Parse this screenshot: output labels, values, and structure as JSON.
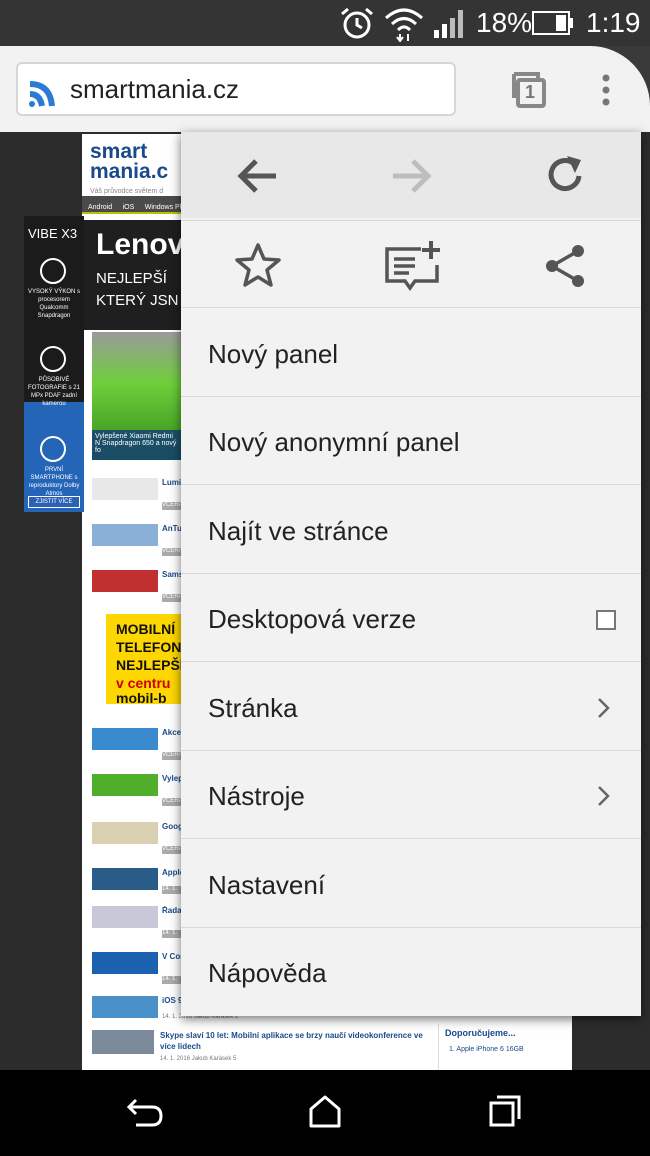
{
  "status_bar": {
    "battery_percent": "18%",
    "time": "1:19",
    "icons": [
      "alarm-icon",
      "wifi-icon",
      "signal-icon",
      "battery-icon"
    ]
  },
  "toolbar": {
    "url": "smartmania.cz",
    "tab_count": "1",
    "icons": [
      "site-logo-icon",
      "tab-switcher-icon",
      "overflow-menu-icon"
    ]
  },
  "menu": {
    "nav_icons": [
      "back-arrow-icon",
      "forward-arrow-icon",
      "reload-icon"
    ],
    "action_icons": [
      "bookmark-star-icon",
      "reading-list-add-icon",
      "share-icon"
    ],
    "items": [
      {
        "label": "Nový panel",
        "kind": "plain"
      },
      {
        "label": "Nový anonymní panel",
        "kind": "plain"
      },
      {
        "label": "Najít ve stránce",
        "kind": "plain"
      },
      {
        "label": "Desktopová verze",
        "kind": "checkbox",
        "checked": false
      },
      {
        "label": "Stránka",
        "kind": "submenu"
      },
      {
        "label": "Nástroje",
        "kind": "submenu"
      },
      {
        "label": "Nastavení",
        "kind": "plain"
      },
      {
        "label": "Nápověda",
        "kind": "plain"
      }
    ]
  },
  "background_page": {
    "logo_line1": "smart",
    "logo_line2": "mania.c",
    "logo_tagline": "Váš průvodce světem d",
    "nav_items": [
      "Android",
      "iOS",
      "Windows Ph"
    ],
    "hero_title": "Lenov",
    "hero_subtitle": "NEJLEPŠÍ KTERÝ JSN",
    "hero_photo_caption": "Vylepšené Xiaomi Redmi N Snapdragon 650 a nový fo",
    "articles": [
      {
        "title": "Lumi střec",
        "meta": "VČERA"
      },
      {
        "title": "AnTu násk",
        "meta": "VČERA"
      },
      {
        "title": "Sams 14nm",
        "meta": "VČERA"
      },
      {
        "title": "Akce 000 l",
        "meta": "VČERA"
      },
      {
        "title": "Vylep fotoa",
        "meta": "VČERA"
      },
      {
        "title": "Goog chyst",
        "meta": "VČERA"
      },
      {
        "title": "Apple",
        "meta": "14. 1."
      },
      {
        "title": "Řada vypa",
        "meta": "14. 1."
      },
      {
        "title": "V Cor pouz",
        "meta": "14. 1."
      },
      {
        "title": "iOS 9",
        "meta": "14. 1. 2016 Jakub Karásek 2"
      }
    ],
    "ad_text": [
      "MOBILNÍ",
      "TELEFON",
      "NEJLEPŠÍ",
      "v centru",
      "mobil-b"
    ],
    "skype_title": "Skype slaví 10 let: Mobilní aplikace se brzy naučí videokonference ve více lidech",
    "skype_meta": "14. 1. 2016  Jakub Karásek  5",
    "recommend_heading": "Doporučujeme...",
    "recommend_item": "1.  Apple iPhone 6 16GB"
  },
  "side_ad": {
    "title": "VIBE X3",
    "features": [
      "VYSOKÝ VÝKON s procesorem Qualcomm Snapdragon",
      "PŮSOBIVÉ FOTOGRAFIE s 21 MPx PDAF zadní kamerou",
      "PRVNÍ SMARTPHONE s reproduktory Dolby Atmos"
    ],
    "cta": "ZJISTIT VÍCE"
  },
  "nav_bar": {
    "icons": [
      "back-icon",
      "home-icon",
      "recents-icon"
    ]
  }
}
